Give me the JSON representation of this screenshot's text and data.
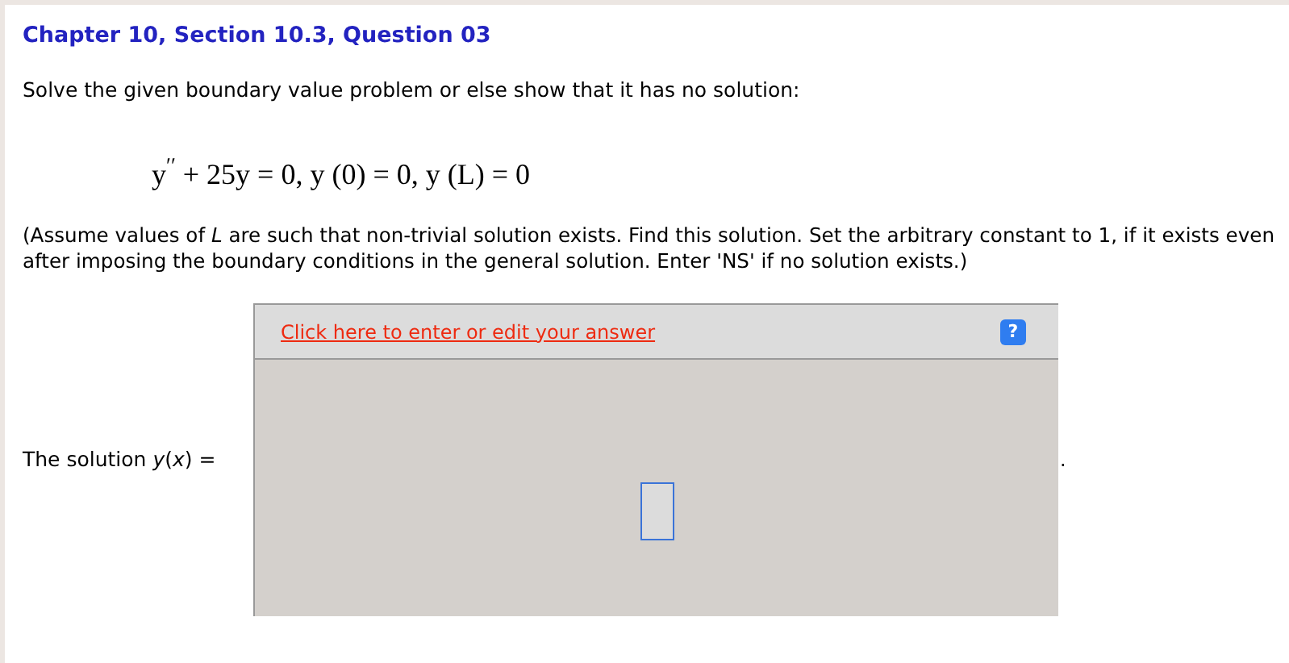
{
  "header": {
    "title": "Chapter 10, Section 10.3, Question 03"
  },
  "prompt": "Solve the given boundary value problem or else show that it has no solution:",
  "equation": "y$^{′′}$ + 25y = 0, y (0) = 0, y (L) = 0",
  "instructions": "(Assume values of *L* are such that non-trivial solution exists. Find this solution. Set the arbitrary constant to 1, if it exists even after imposing the boundary conditions in the general solution. Enter 'NS' if no solution exists.)",
  "answer": {
    "label": "The solution *y*(*x*) =",
    "edit_link": "Click here to enter or edit your answer",
    "help_button": "?",
    "trailing": "."
  }
}
